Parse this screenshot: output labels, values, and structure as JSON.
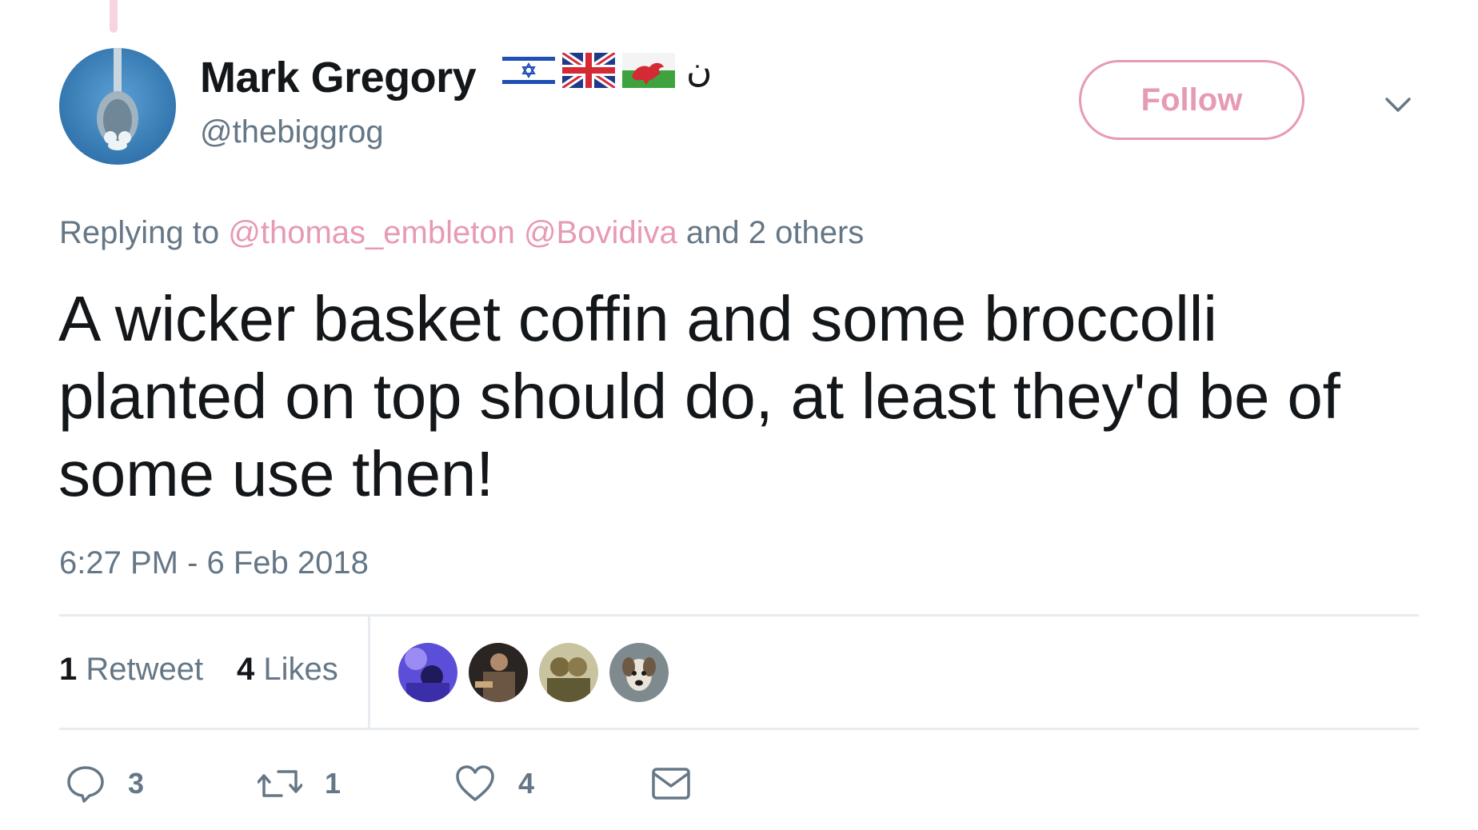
{
  "colors": {
    "accent_pink": "#e79ab3",
    "thread_line": "#f7d5df",
    "text_primary": "#14171a",
    "text_secondary": "#657786",
    "divider": "#e6ecf0"
  },
  "author": {
    "name": "Mark Gregory",
    "handle": "@thebiggrog",
    "avatar_icon": "spoon-avatar",
    "name_flags": [
      "israel-flag-icon",
      "union-jack-flag-icon",
      "wales-flag-icon"
    ],
    "name_suffix": "ن"
  },
  "follow_button": {
    "label": "Follow"
  },
  "more_menu_icon": "chevron-down-icon",
  "reply_context": {
    "prefix": "Replying to",
    "mentions": [
      "@thomas_embleton",
      "@Bovidiva"
    ],
    "suffix": "and 2 others"
  },
  "tweet": {
    "text": "A wicker basket coffin and some broccolli planted on top should do, at least they'd be of some use then!",
    "timestamp": "6:27 PM - 6 Feb 2018"
  },
  "stats": {
    "retweets": {
      "count": "1",
      "label": "Retweet"
    },
    "likes": {
      "count": "4",
      "label": "Likes"
    },
    "liker_avatars": [
      "liker-avatar-1",
      "liker-avatar-2",
      "liker-avatar-3",
      "liker-avatar-4"
    ]
  },
  "actions": {
    "reply": {
      "icon": "reply-bubble-icon",
      "count": "3"
    },
    "retweet": {
      "icon": "retweet-icon",
      "count": "1"
    },
    "like": {
      "icon": "heart-icon",
      "count": "4"
    },
    "message": {
      "icon": "envelope-icon"
    }
  }
}
